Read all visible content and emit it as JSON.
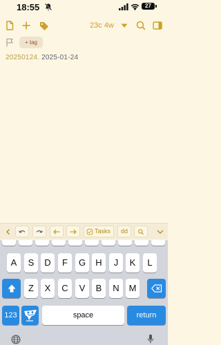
{
  "status_bar": {
    "time": "18:55",
    "battery": "27",
    "icons": [
      "bell-slash-icon",
      "signal-icon",
      "wifi-icon",
      "battery-icon"
    ]
  },
  "toolbar": {
    "stats": "23c 4w",
    "icons": [
      "new-document-icon",
      "plus-icon",
      "tag-icon",
      "dropdown-triangle-icon",
      "search-icon",
      "sidebar-icon"
    ],
    "accent_color": "#c9a227"
  },
  "tag_row": {
    "tag_button_label": "+ tag",
    "icons": [
      "flag-icon"
    ]
  },
  "editor": {
    "doc_id": "20250124.",
    "doc_date": "2025-01-24"
  },
  "accessory_bar": {
    "tasks_label": "Tasks",
    "dd_label": "dd",
    "icons": [
      "chevron-left-icon",
      "undo-icon",
      "redo-icon",
      "arrow-left-icon",
      "arrow-right-icon",
      "checkbox-icon",
      "search-icon",
      "chevron-down-icon"
    ]
  },
  "keyboard": {
    "row2": [
      "A",
      "S",
      "D",
      "F",
      "G",
      "H",
      "J",
      "K",
      "L"
    ],
    "row3": [
      "Z",
      "X",
      "C",
      "V",
      "B",
      "N",
      "M"
    ],
    "num_label": "123",
    "space_label": "space",
    "return_label": "return",
    "key_color": "#2a8ae0",
    "icons": [
      "shift-icon",
      "backspace-icon",
      "emoji-keyboard-icon",
      "globe-icon",
      "microphone-icon"
    ]
  }
}
